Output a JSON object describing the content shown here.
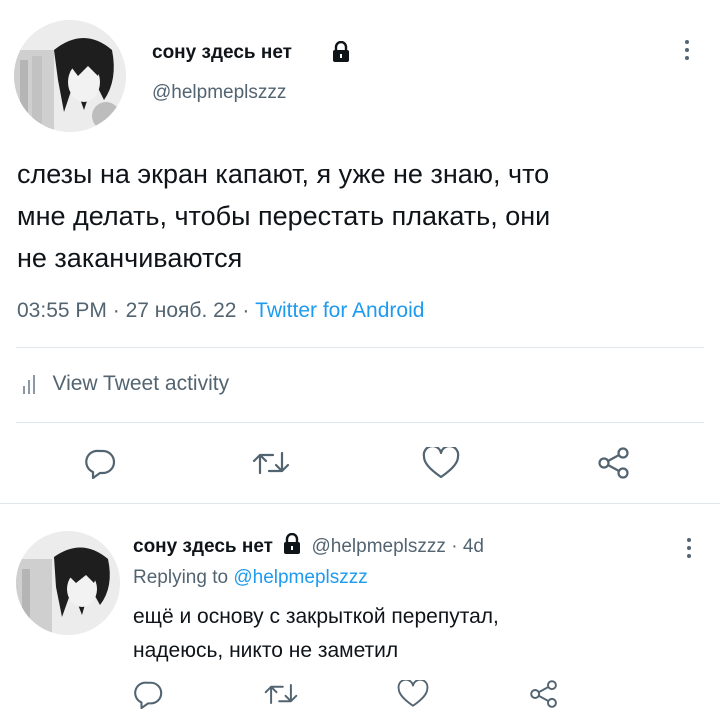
{
  "main_tweet": {
    "author_name": "сону здесь нет",
    "handle": "@helpmeplszzz",
    "text_line1": "слезы на экран капают, я уже не знаю, что",
    "text_line2": "мне делать, чтобы перестать плакать, они",
    "text_line3": "не заканчиваются",
    "time": "03:55 PM",
    "sep1": "·",
    "date": "27 нояб. 22",
    "sep2": "·",
    "source": "Twitter for Android",
    "activity_label": "View Tweet activity"
  },
  "reply": {
    "author_name": "сону здесь нет",
    "handle": "@helpmeplszzz",
    "sep": "·",
    "age": "4d",
    "replying_prefix": "Replying to",
    "replying_handle": "@helpmeplszzz",
    "text_line1": "ещё и основу с закрыткой перепутал,",
    "text_line2": "надеюсь, никто не заметил"
  },
  "icons": [
    "lock-icon",
    "more-icon",
    "chart-icon",
    "reply-icon",
    "retweet-icon",
    "like-icon",
    "share-icon"
  ],
  "colors": {
    "accent": "#1d9bf0",
    "text": "#0f1419",
    "muted": "#536471",
    "divider": "#e1e6ea"
  }
}
